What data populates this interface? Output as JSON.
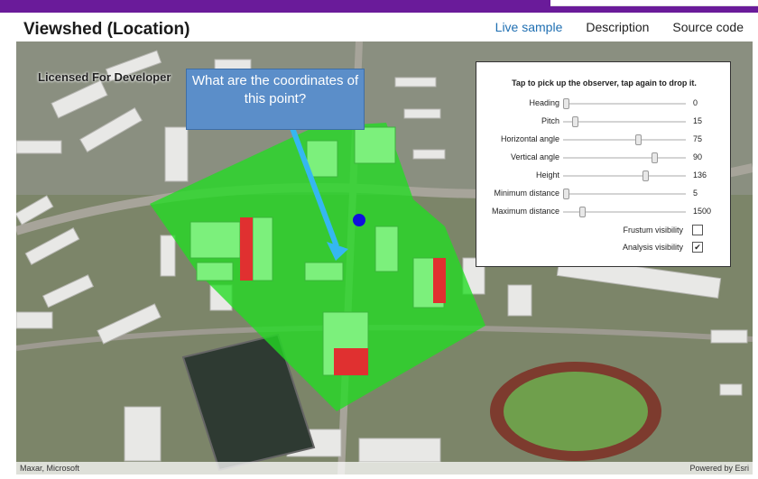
{
  "header": {
    "title": "Viewshed (Location)",
    "tabs": [
      {
        "label": "Live sample",
        "active": true
      },
      {
        "label": "Description",
        "active": false
      },
      {
        "label": "Source code",
        "active": false
      }
    ]
  },
  "map": {
    "watermark": "Licensed For Developer",
    "attribution_left": "Maxar, Microsoft",
    "attribution_right": "Powered by Esri",
    "viewshed_visible_color": "#22dd22",
    "viewshed_hidden_color": "#e03030",
    "observer_color": "#1010dd"
  },
  "callout": {
    "text": "What are the coordinates of this point?"
  },
  "panel": {
    "hint": "Tap to pick up the observer, tap again to drop it.",
    "sliders": [
      {
        "label": "Heading",
        "value": "0",
        "fraction": 0.0
      },
      {
        "label": "Pitch",
        "value": "15",
        "fraction": 0.08
      },
      {
        "label": "Horizontal angle",
        "value": "75",
        "fraction": 0.6
      },
      {
        "label": "Vertical angle",
        "value": "90",
        "fraction": 0.73
      },
      {
        "label": "Height",
        "value": "136",
        "fraction": 0.66
      },
      {
        "label": "Minimum distance",
        "value": "5",
        "fraction": 0.0
      },
      {
        "label": "Maximum distance",
        "value": "1500",
        "fraction": 0.14
      }
    ],
    "checkboxes": [
      {
        "label": "Frustum visibility",
        "checked": false
      },
      {
        "label": "Analysis visibility",
        "checked": true
      }
    ]
  }
}
